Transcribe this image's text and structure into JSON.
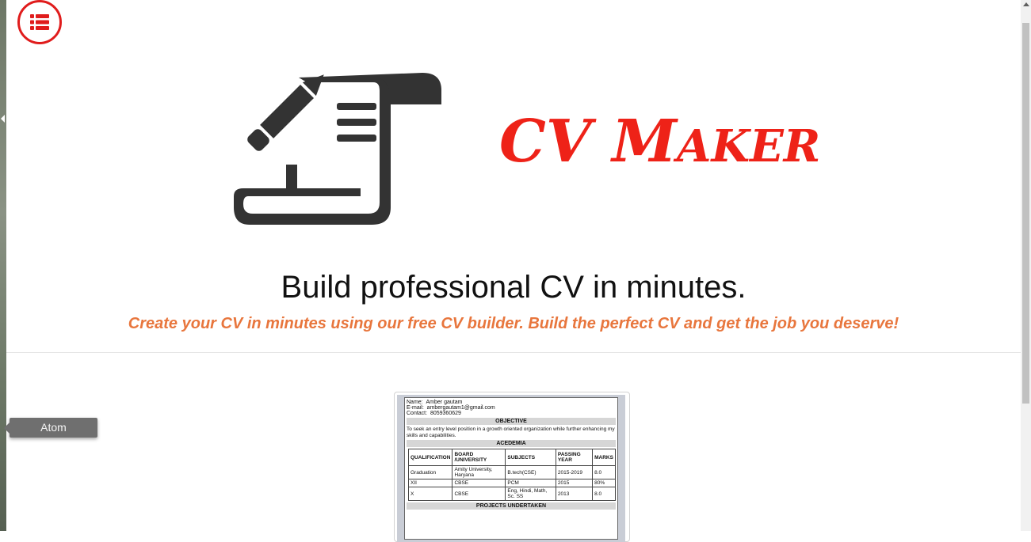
{
  "app": {
    "brand_cv": "CV ",
    "brand_m": "M",
    "brand_rest": "AKER",
    "headline": "Build professional CV in minutes.",
    "subline": "Create your CV in minutes using our free CV builder. Build the perfect CV and get the job you deserve!"
  },
  "menu": {
    "icon": "list-icon"
  },
  "tooltip": {
    "label": "Atom"
  },
  "colors": {
    "accent": "#ee2218",
    "subline": "#e8763d",
    "icon_dark": "#333333"
  },
  "cv_preview": {
    "name_label": "Name:",
    "name_value": "Amber gautam",
    "email_label": "E-mail:",
    "email_value": "ambergautam1@gmail.com",
    "contact_label": "Contact:",
    "contact_value": "8059360629",
    "objective_title": "OBJECTIVE",
    "objective_text": "To seek an entry level position in a growth oriented organization while further enhancing my skills and capabilities.",
    "academia_title": "ACEDEMIA",
    "columns": [
      "QUALIFICATION",
      "BOARD /UNIVERSITY",
      "SUBJECTS",
      "PASSING YEAR",
      "MARKS"
    ],
    "rows": [
      [
        "Graduation",
        "Amity University, Haryana",
        "B.tech(CSE)",
        "2015-2019",
        "8.0"
      ],
      [
        "XII",
        "CBSE",
        "PCM",
        "2015",
        "80%"
      ],
      [
        "X",
        "CBSE",
        "Eng, Hindi, Math, Sc. SS",
        "2013",
        "8.0"
      ]
    ],
    "projects_title": "PROJECTS UNDERTAKEN"
  }
}
